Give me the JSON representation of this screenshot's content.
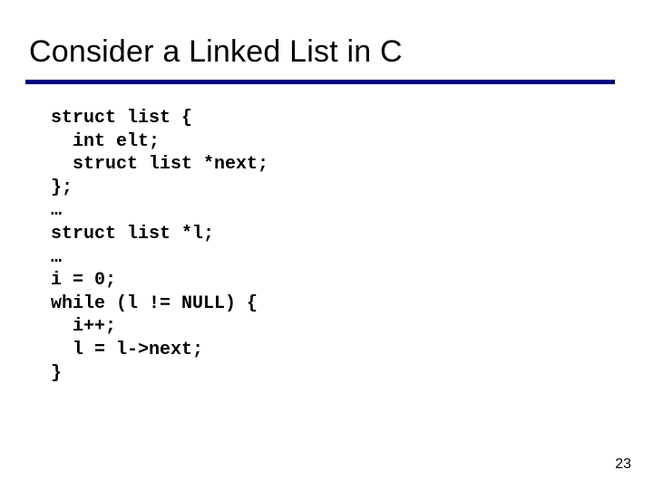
{
  "title": "Consider a Linked List in C",
  "code": "struct list {\n  int elt;\n  struct list *next;\n};\n…\nstruct list *l;\n…\ni = 0;\nwhile (l != NULL) {\n  i++;\n  l = l->next;\n}",
  "page_number": "23",
  "colors": {
    "rule": "#000080"
  }
}
